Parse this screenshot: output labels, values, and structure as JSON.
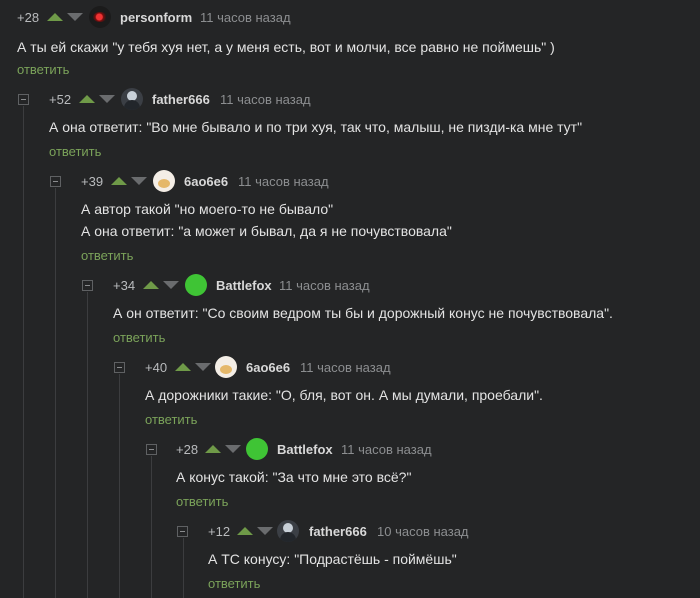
{
  "accent_color": "#7ba35a",
  "background_color": "#242526",
  "comments": [
    {
      "rating": "+28",
      "username": "personform",
      "time": "11 часов назад",
      "avatar": "personform-avatar",
      "lines": [
        "А ты ей скажи \"у тебя хуя нет, а у меня есть, вот и молчи, все равно не поймешь\" )"
      ],
      "reply_label": "ответить"
    },
    {
      "rating": "+52",
      "username": "father666",
      "time": "11 часов назад",
      "avatar": "father666-avatar",
      "lines": [
        "А она ответит: \"Во мне бывало и по три хуя, так что, малыш, не пизди-ка мне тут\""
      ],
      "reply_label": "ответить"
    },
    {
      "rating": "+39",
      "username": "6ao6e6",
      "time": "11 часов назад",
      "avatar": "6ao6e6-avatar",
      "lines": [
        "А автор такой \"но моего-то не бывало\"",
        "А она ответит: \"а может и бывал, да я не почувствовала\""
      ],
      "reply_label": "ответить"
    },
    {
      "rating": "+34",
      "username": "Battlefox",
      "time": "11 часов назад",
      "avatar": "battlefox-avatar",
      "lines": [
        "А он ответит: \"Со своим ведром ты бы и дорожный конус не почувствовала\"."
      ],
      "reply_label": "ответить"
    },
    {
      "rating": "+40",
      "username": "6ao6e6",
      "time": "11 часов назад",
      "avatar": "6ao6e6-avatar",
      "lines": [
        "А дорожники такие: \"О, бля, вот он. А мы думали, проебали\"."
      ],
      "reply_label": "ответить"
    },
    {
      "rating": "+28",
      "username": "Battlefox",
      "time": "11 часов назад",
      "avatar": "battlefox-avatar",
      "lines": [
        "А конус такой: \"За что мне это всё?\""
      ],
      "reply_label": "ответить"
    },
    {
      "rating": "+12",
      "username": "father666",
      "time": "10 часов назад",
      "avatar": "father666-avatar",
      "lines": [
        "А ТС конусу: \"Подрастёшь - поймёшь\""
      ],
      "reply_label": "ответить"
    }
  ]
}
